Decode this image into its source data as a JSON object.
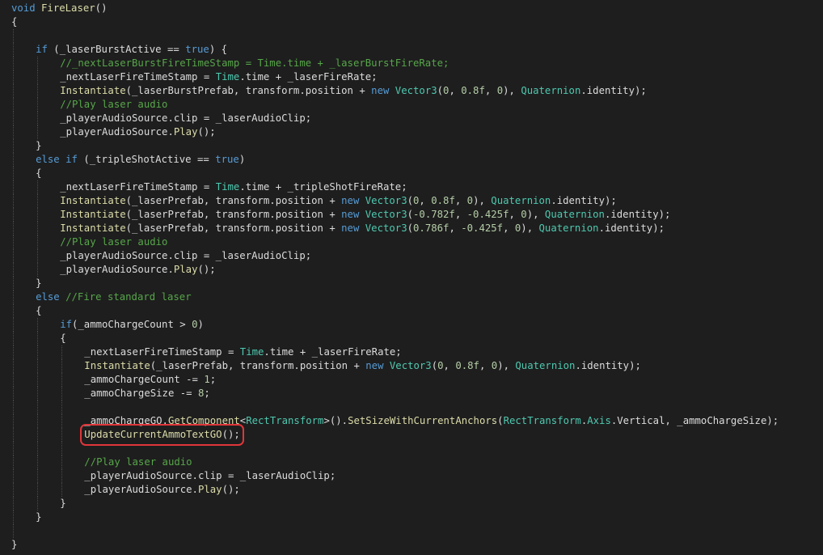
{
  "editor": {
    "highlight_color": "#e0363a",
    "colors": {
      "background": "#1e1e1e",
      "plain": "#dcdcdc",
      "keyword": "#569cd6",
      "comment": "#57a64a",
      "method": "#dcdcaa",
      "type": "#4ec9b0",
      "number": "#b5cea8"
    },
    "lines": [
      {
        "indent": 0,
        "tokens": [
          [
            "kw",
            "void"
          ],
          [
            "tx",
            " "
          ],
          [
            "fn",
            "FireLaser"
          ],
          [
            "tx",
            "()"
          ]
        ]
      },
      {
        "indent": 0,
        "tokens": [
          [
            "tx",
            "{"
          ]
        ]
      },
      {
        "indent": 1,
        "tokens": []
      },
      {
        "indent": 1,
        "tokens": [
          [
            "kw",
            "if"
          ],
          [
            "tx",
            " (_laserBurstActive == "
          ],
          [
            "kw",
            "true"
          ],
          [
            "tx",
            ") {"
          ]
        ]
      },
      {
        "indent": 2,
        "tokens": [
          [
            "cm",
            "//_nextLaserBurstFireTimeStamp = Time.time + _laserBurstFireRate;"
          ]
        ]
      },
      {
        "indent": 2,
        "tokens": [
          [
            "tx",
            "_nextLaserFireTimeStamp = "
          ],
          [
            "ty",
            "Time"
          ],
          [
            "tx",
            ".time + _laserFireRate;"
          ]
        ]
      },
      {
        "indent": 2,
        "tokens": [
          [
            "fn",
            "Instantiate"
          ],
          [
            "tx",
            "(_laserBurstPrefab, transform.position + "
          ],
          [
            "kw",
            "new"
          ],
          [
            "tx",
            " "
          ],
          [
            "ty",
            "Vector3"
          ],
          [
            "tx",
            "("
          ],
          [
            "nm",
            "0"
          ],
          [
            "tx",
            ", "
          ],
          [
            "nm",
            "0.8f"
          ],
          [
            "tx",
            ", "
          ],
          [
            "nm",
            "0"
          ],
          [
            "tx",
            "), "
          ],
          [
            "ty",
            "Quaternion"
          ],
          [
            "tx",
            ".identity);"
          ]
        ]
      },
      {
        "indent": 2,
        "tokens": [
          [
            "cm",
            "//Play laser audio"
          ]
        ]
      },
      {
        "indent": 2,
        "tokens": [
          [
            "tx",
            "_playerAudioSource.clip = _laserAudioClip;"
          ]
        ]
      },
      {
        "indent": 2,
        "tokens": [
          [
            "tx",
            "_playerAudioSource."
          ],
          [
            "fn",
            "Play"
          ],
          [
            "tx",
            "();"
          ]
        ]
      },
      {
        "indent": 1,
        "tokens": [
          [
            "tx",
            "}"
          ]
        ]
      },
      {
        "indent": 1,
        "tokens": [
          [
            "kw",
            "else if"
          ],
          [
            "tx",
            " (_tripleShotActive == "
          ],
          [
            "kw",
            "true"
          ],
          [
            "tx",
            ")"
          ]
        ]
      },
      {
        "indent": 1,
        "tokens": [
          [
            "tx",
            "{"
          ]
        ]
      },
      {
        "indent": 2,
        "tokens": [
          [
            "tx",
            "_nextLaserFireTimeStamp = "
          ],
          [
            "ty",
            "Time"
          ],
          [
            "tx",
            ".time + _tripleShotFireRate;"
          ]
        ]
      },
      {
        "indent": 2,
        "tokens": [
          [
            "fn",
            "Instantiate"
          ],
          [
            "tx",
            "(_laserPrefab, transform.position + "
          ],
          [
            "kw",
            "new"
          ],
          [
            "tx",
            " "
          ],
          [
            "ty",
            "Vector3"
          ],
          [
            "tx",
            "("
          ],
          [
            "nm",
            "0"
          ],
          [
            "tx",
            ", "
          ],
          [
            "nm",
            "0.8f"
          ],
          [
            "tx",
            ", "
          ],
          [
            "nm",
            "0"
          ],
          [
            "tx",
            "), "
          ],
          [
            "ty",
            "Quaternion"
          ],
          [
            "tx",
            ".identity);"
          ]
        ]
      },
      {
        "indent": 2,
        "tokens": [
          [
            "fn",
            "Instantiate"
          ],
          [
            "tx",
            "(_laserPrefab, transform.position + "
          ],
          [
            "kw",
            "new"
          ],
          [
            "tx",
            " "
          ],
          [
            "ty",
            "Vector3"
          ],
          [
            "tx",
            "("
          ],
          [
            "nm",
            "-0.782f"
          ],
          [
            "tx",
            ", "
          ],
          [
            "nm",
            "-0.425f"
          ],
          [
            "tx",
            ", "
          ],
          [
            "nm",
            "0"
          ],
          [
            "tx",
            "), "
          ],
          [
            "ty",
            "Quaternion"
          ],
          [
            "tx",
            ".identity);"
          ]
        ]
      },
      {
        "indent": 2,
        "tokens": [
          [
            "fn",
            "Instantiate"
          ],
          [
            "tx",
            "(_laserPrefab, transform.position + "
          ],
          [
            "kw",
            "new"
          ],
          [
            "tx",
            " "
          ],
          [
            "ty",
            "Vector3"
          ],
          [
            "tx",
            "("
          ],
          [
            "nm",
            "0.786f"
          ],
          [
            "tx",
            ", "
          ],
          [
            "nm",
            "-0.425f"
          ],
          [
            "tx",
            ", "
          ],
          [
            "nm",
            "0"
          ],
          [
            "tx",
            "), "
          ],
          [
            "ty",
            "Quaternion"
          ],
          [
            "tx",
            ".identity);"
          ]
        ]
      },
      {
        "indent": 2,
        "tokens": [
          [
            "cm",
            "//Play laser audio"
          ]
        ]
      },
      {
        "indent": 2,
        "tokens": [
          [
            "tx",
            "_playerAudioSource.clip = _laserAudioClip;"
          ]
        ]
      },
      {
        "indent": 2,
        "tokens": [
          [
            "tx",
            "_playerAudioSource."
          ],
          [
            "fn",
            "Play"
          ],
          [
            "tx",
            "();"
          ]
        ]
      },
      {
        "indent": 1,
        "tokens": [
          [
            "tx",
            "}"
          ]
        ]
      },
      {
        "indent": 1,
        "tokens": [
          [
            "kw",
            "else"
          ],
          [
            "tx",
            " "
          ],
          [
            "cm",
            "//Fire standard laser"
          ]
        ]
      },
      {
        "indent": 1,
        "tokens": [
          [
            "tx",
            "{"
          ]
        ]
      },
      {
        "indent": 2,
        "tokens": [
          [
            "kw",
            "if"
          ],
          [
            "tx",
            "(_ammoChargeCount > "
          ],
          [
            "nm",
            "0"
          ],
          [
            "tx",
            ")"
          ]
        ]
      },
      {
        "indent": 2,
        "tokens": [
          [
            "tx",
            "{"
          ]
        ]
      },
      {
        "indent": 3,
        "tokens": [
          [
            "tx",
            "_nextLaserFireTimeStamp = "
          ],
          [
            "ty",
            "Time"
          ],
          [
            "tx",
            ".time + _laserFireRate;"
          ]
        ]
      },
      {
        "indent": 3,
        "tokens": [
          [
            "fn",
            "Instantiate"
          ],
          [
            "tx",
            "(_laserPrefab, transform.position + "
          ],
          [
            "kw",
            "new"
          ],
          [
            "tx",
            " "
          ],
          [
            "ty",
            "Vector3"
          ],
          [
            "tx",
            "("
          ],
          [
            "nm",
            "0"
          ],
          [
            "tx",
            ", "
          ],
          [
            "nm",
            "0.8f"
          ],
          [
            "tx",
            ", "
          ],
          [
            "nm",
            "0"
          ],
          [
            "tx",
            "), "
          ],
          [
            "ty",
            "Quaternion"
          ],
          [
            "tx",
            ".identity);"
          ]
        ]
      },
      {
        "indent": 3,
        "tokens": [
          [
            "tx",
            "_ammoChargeCount -= "
          ],
          [
            "nm",
            "1"
          ],
          [
            "tx",
            ";"
          ]
        ]
      },
      {
        "indent": 3,
        "tokens": [
          [
            "tx",
            "_ammoChargeSize -= "
          ],
          [
            "nm",
            "8"
          ],
          [
            "tx",
            ";"
          ]
        ]
      },
      {
        "indent": 3,
        "tokens": []
      },
      {
        "indent": 3,
        "tokens": [
          [
            "tx",
            "_ammoChargeGO."
          ],
          [
            "fn",
            "GetComponent"
          ],
          [
            "tx",
            "<"
          ],
          [
            "ty",
            "RectTransform"
          ],
          [
            "tx",
            ">()."
          ],
          [
            "fn",
            "SetSizeWithCurrentAnchors"
          ],
          [
            "tx",
            "("
          ],
          [
            "ty",
            "RectTransform"
          ],
          [
            "tx",
            "."
          ],
          [
            "ty",
            "Axis"
          ],
          [
            "tx",
            ".Vertical, _ammoChargeSize);"
          ]
        ]
      },
      {
        "indent": 3,
        "highlight": true,
        "tokens": [
          [
            "fn",
            "UpdateCurrentAmmoTextGO"
          ],
          [
            "tx",
            "();"
          ]
        ]
      },
      {
        "indent": 3,
        "tokens": []
      },
      {
        "indent": 3,
        "tokens": [
          [
            "cm",
            "//Play laser audio"
          ]
        ]
      },
      {
        "indent": 3,
        "tokens": [
          [
            "tx",
            "_playerAudioSource.clip = _laserAudioClip;"
          ]
        ]
      },
      {
        "indent": 3,
        "tokens": [
          [
            "tx",
            "_playerAudioSource."
          ],
          [
            "fn",
            "Play"
          ],
          [
            "tx",
            "();"
          ]
        ]
      },
      {
        "indent": 2,
        "tokens": [
          [
            "tx",
            "}"
          ]
        ]
      },
      {
        "indent": 1,
        "tokens": [
          [
            "tx",
            "}"
          ]
        ]
      },
      {
        "indent": 1,
        "tokens": []
      },
      {
        "indent": 0,
        "tokens": [
          [
            "tx",
            "}"
          ]
        ]
      }
    ]
  }
}
